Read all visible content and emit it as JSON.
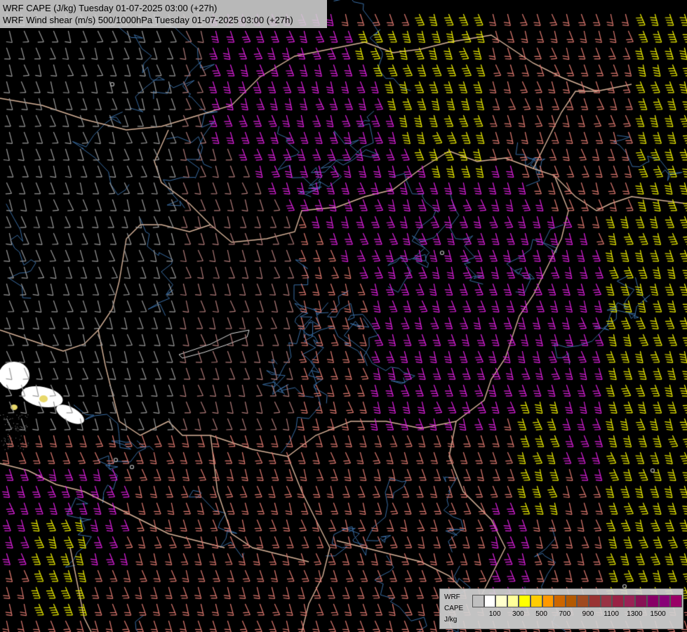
{
  "header": {
    "line1": "WRF CAPE (J/kg) Tuesday 01-07-2025 03:00 (+27h)",
    "line2": "WRF Wind shear (m/s) 500/1000hPa Tuesday 01-07-2025 03:00 (+27h)"
  },
  "legend": {
    "title1": "WRF",
    "title2": "CAPE",
    "title3": "J/kg",
    "colors": [
      "#bfbfbf",
      "#ffffff",
      "#ffffcc",
      "#ffff99",
      "#ffff00",
      "#ffcc00",
      "#ff9900",
      "#cc6600",
      "#b35900",
      "#a04a20",
      "#993333",
      "#993344",
      "#992244",
      "#992255",
      "#881155",
      "#880066",
      "#880077",
      "#990066"
    ],
    "ticks": [
      "100",
      "300",
      "500",
      "700",
      "900",
      "1100",
      "1300",
      "1500"
    ]
  },
  "map_colors": {
    "background": "#000000",
    "borders": "#d9b49a",
    "rivers": "#3a6ea5",
    "barb_low": "#9a9a9a",
    "barb_midlow": "#b07a78",
    "barb_mid": "#e07a70",
    "barb_high": "#e020e0",
    "barb_extreme": "#f0f000",
    "cape_white": "#ffffff",
    "cape_yellow": "#e8d86a"
  }
}
